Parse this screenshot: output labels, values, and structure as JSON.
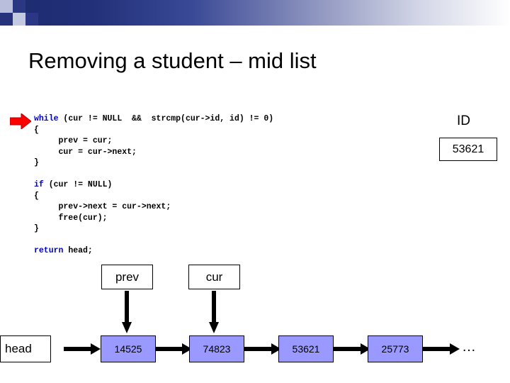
{
  "slide": {
    "title": "Removing a student – mid list",
    "code_lines": [
      {
        "segments": [
          {
            "t": "while",
            "style": "kw"
          },
          {
            "t": " (cur != NULL  &&  strcmp(cur->id, id) != 0)",
            "style": "bold"
          }
        ]
      },
      {
        "segments": [
          {
            "t": "{",
            "style": "bold"
          }
        ]
      },
      {
        "segments": [
          {
            "t": "     prev = cur;",
            "style": "bold"
          }
        ]
      },
      {
        "segments": [
          {
            "t": "     cur = cur->next;",
            "style": "bold"
          }
        ]
      },
      {
        "segments": [
          {
            "t": "}",
            "style": "bold"
          }
        ]
      },
      {
        "segments": [
          {
            "t": "",
            "style": "bold"
          }
        ]
      },
      {
        "segments": [
          {
            "t": "if",
            "style": "kw"
          },
          {
            "t": " (cur != NULL)",
            "style": "bold"
          }
        ]
      },
      {
        "segments": [
          {
            "t": "{",
            "style": "bold"
          }
        ]
      },
      {
        "segments": [
          {
            "t": "     prev->next = cur->next;",
            "style": "bold"
          }
        ]
      },
      {
        "segments": [
          {
            "t": "     free(cur);",
            "style": "bold"
          }
        ]
      },
      {
        "segments": [
          {
            "t": "}",
            "style": "bold"
          }
        ]
      },
      {
        "segments": [
          {
            "t": "",
            "style": "bold"
          }
        ]
      },
      {
        "segments": [
          {
            "t": "return",
            "style": "kw"
          },
          {
            "t": " head;",
            "style": "bold"
          }
        ]
      }
    ],
    "id_label": "ID",
    "id_value": "53621",
    "pointers": {
      "prev": "prev",
      "cur": "cur"
    },
    "list": {
      "head_label": "head",
      "nodes": [
        "14525",
        "74823",
        "53621",
        "25773"
      ],
      "tail_ellipsis": "…"
    },
    "colors": {
      "node_fill": "#9999ff",
      "keyword": "#0000c8",
      "arrow_red": "#ff0000",
      "banner_dark": "#1c2a6e"
    }
  }
}
